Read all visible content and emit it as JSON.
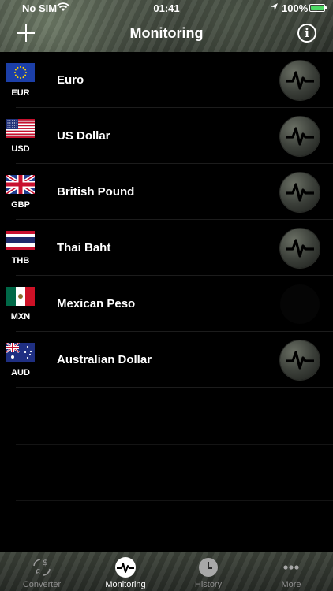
{
  "status_bar": {
    "carrier": "No SIM",
    "time": "01:41",
    "battery_percent": "100%"
  },
  "nav": {
    "title": "Monitoring",
    "add_icon": "plus-icon",
    "info_icon": "info-icon"
  },
  "currencies": [
    {
      "code": "EUR",
      "name": "Euro",
      "flag": "eu",
      "monitoring": true
    },
    {
      "code": "USD",
      "name": "US Dollar",
      "flag": "us",
      "monitoring": true
    },
    {
      "code": "GBP",
      "name": "British Pound",
      "flag": "gb",
      "monitoring": true
    },
    {
      "code": "THB",
      "name": "Thai Baht",
      "flag": "th",
      "monitoring": true
    },
    {
      "code": "MXN",
      "name": "Mexican Peso",
      "flag": "mx",
      "monitoring": false
    },
    {
      "code": "AUD",
      "name": "Australian Dollar",
      "flag": "au",
      "monitoring": true
    }
  ],
  "tabs": [
    {
      "label": "Converter",
      "icon": "converter-icon",
      "active": false
    },
    {
      "label": "Monitoring",
      "icon": "pulse-icon",
      "active": true
    },
    {
      "label": "History",
      "icon": "clock-icon",
      "active": false
    },
    {
      "label": "More",
      "icon": "more-icon",
      "active": false
    }
  ],
  "colors": {
    "battery": "#4cd964",
    "tab_inactive": "#8e8e8e"
  }
}
